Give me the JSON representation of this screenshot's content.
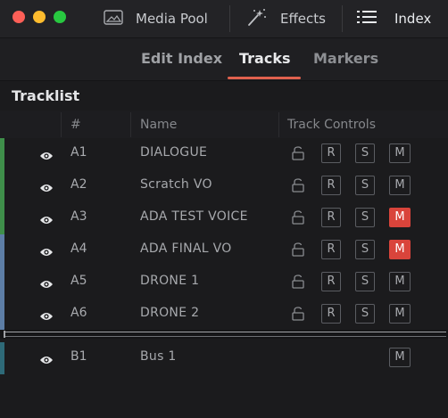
{
  "toolbar": {
    "media_pool_label": "Media Pool",
    "effects_label": "Effects",
    "index_label": "Index"
  },
  "tabs": [
    {
      "label": "Edit Index",
      "active": false
    },
    {
      "label": "Tracks",
      "active": true
    },
    {
      "label": "Markers",
      "active": false
    }
  ],
  "tracklist": {
    "title": "Tracklist",
    "columns": {
      "number": "#",
      "name": "Name",
      "controls": "Track Controls"
    }
  },
  "controls": {
    "record": "R",
    "solo": "S",
    "mute": "M"
  },
  "tracks": [
    {
      "id": "A1",
      "name": "DIALOGUE",
      "muted": false,
      "color": "#3f8f4a"
    },
    {
      "id": "A2",
      "name": "Scratch VO",
      "muted": false,
      "color": "#3f8f4a"
    },
    {
      "id": "A3",
      "name": "ADA TEST VOICE",
      "muted": true,
      "color": "#3f8f4a"
    },
    {
      "id": "A4",
      "name": "ADA FINAL VO",
      "muted": true,
      "color": "#5d7ea6"
    },
    {
      "id": "A5",
      "name": "DRONE 1",
      "muted": false,
      "color": "#5d7ea6"
    },
    {
      "id": "A6",
      "name": "DRONE 2",
      "muted": false,
      "color": "#5d7ea6"
    }
  ],
  "bus": {
    "id": "B1",
    "name": "Bus 1",
    "muted": false,
    "color": "#2e6a78"
  },
  "colors": {
    "accent": "#e0614e",
    "mute_active": "#d9443b"
  }
}
